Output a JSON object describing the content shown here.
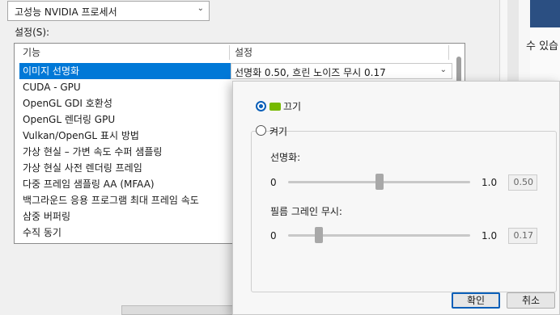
{
  "processor_select": {
    "value": "고성능 NVIDIA 프로세서"
  },
  "settings_label": "설정(S):",
  "table": {
    "columns": [
      "기능",
      "설정"
    ],
    "rows": [
      "이미지 선명화",
      "CUDA - GPU",
      "OpenGL GDI 호환성",
      "OpenGL 렌더링 GPU",
      "Vulkan/OpenGL 표시 방법",
      "가상 현실 – 가변 속도 수퍼 샘플링",
      "가상 현실 사전 렌더링 프레임",
      "다중 프레임 샘플링 AA (MFAA)",
      "백그라운드 응용 프로그램 최대 프레임 속도",
      "삼중 버퍼링",
      "수직 동기"
    ],
    "selected_row_index": 0,
    "selected_row_setting": "선명화 0.50, 흐린 노이즈 무시 0.17"
  },
  "background_text": "수 있습",
  "popup": {
    "option_off": "끄기",
    "option_on": "켜기",
    "selected_option": "끄기",
    "sharpen": {
      "label": "선명화:",
      "min": "0",
      "max": "1.0",
      "value": "0.50",
      "fraction": 0.5
    },
    "grain": {
      "label": "필름 그레인 무시:",
      "min": "0",
      "max": "1.0",
      "value": "0.17",
      "fraction": 0.17
    },
    "ok_label": "확인",
    "cancel_label": "취소"
  },
  "colors": {
    "selection": "#0078d7",
    "nvidia_logo": "#76b900",
    "accent": "#0a5fb8"
  }
}
